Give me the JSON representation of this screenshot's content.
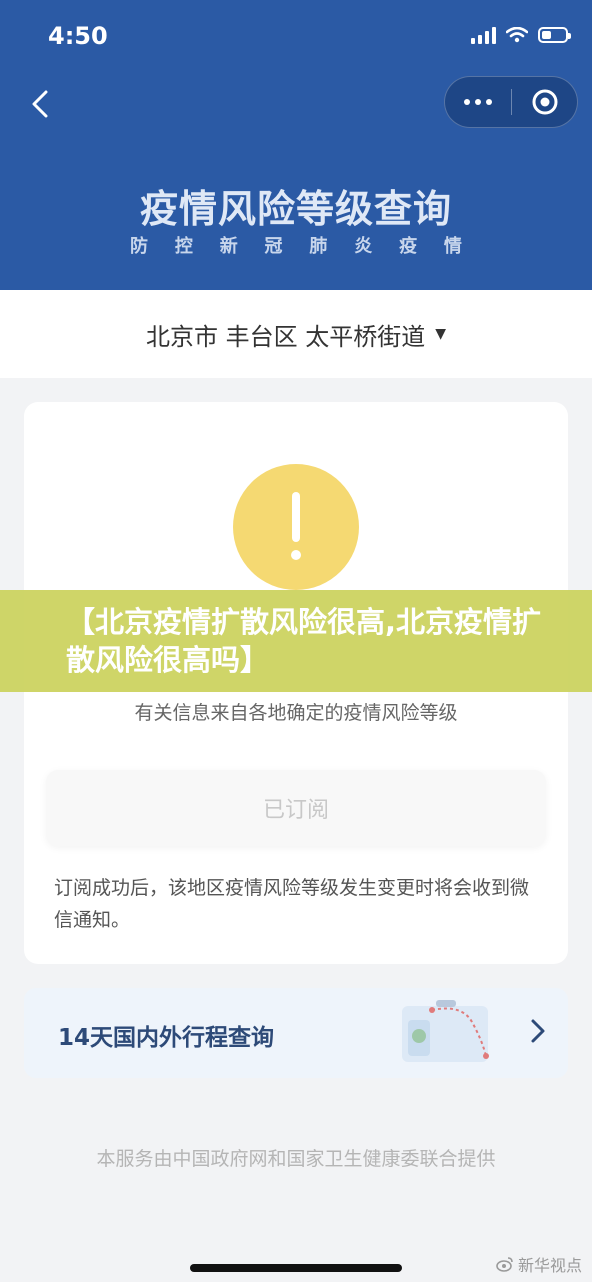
{
  "status_bar": {
    "time": "4:50",
    "battery_level": 0.4
  },
  "header": {
    "title": "疫情风险等级查询",
    "subtitle_chars": [
      "防",
      "控",
      "新",
      "冠",
      "肺",
      "炎",
      "疫",
      "情"
    ],
    "background": "#2b5aa5"
  },
  "region": {
    "text": "北京市 丰台区 太平桥街道",
    "dropdown_icon": "caret-down-icon"
  },
  "risk_card": {
    "alert_icon": "exclamation-icon",
    "alert_color": "#f5d972",
    "description": "有关信息来自各地确定的疫情风险等级",
    "subscribe_label": "已订阅",
    "note": "订阅成功后，该地区疫情风险等级发生变更时将会收到微信通知。"
  },
  "overlay_banner": {
    "text": "【北京疫情扩散风险很高,北京疫情扩散风险很高吗】",
    "color": "#cbd25c"
  },
  "trip_card": {
    "title": "14天国内外行程查询"
  },
  "footer": {
    "text": "本服务由中国政府网和国家卫生健康委联合提供"
  },
  "watermark": {
    "text": "新华视点"
  }
}
